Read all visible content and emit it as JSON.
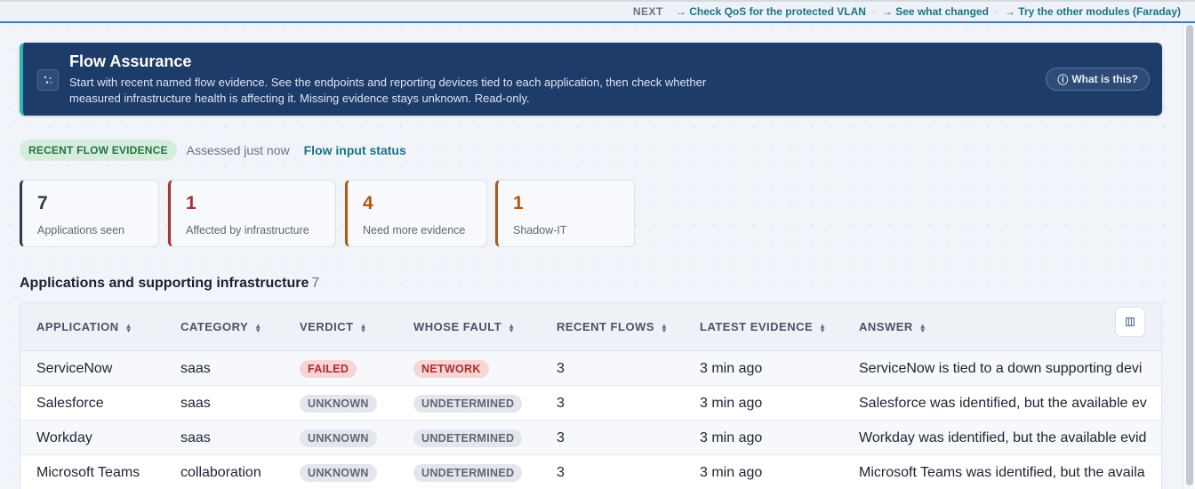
{
  "topbar": {
    "next_label": "NEXT",
    "links": [
      "→ Check QoS for the protected VLAN",
      "→ See what changed",
      "→ Try the other modules (Faraday)"
    ],
    "separator": "·"
  },
  "banner": {
    "icon": "sparkle-icon",
    "title": "Flow Assurance",
    "description": "Start with recent named flow evidence. See the endpoints and reporting devices tied to each application, then check whether measured infrastructure health is affecting it. Missing evidence stays unknown. Read-only.",
    "what_button": "What is this?",
    "what_button_icon": "ⓘ"
  },
  "status": {
    "badge": "RECENT FLOW EVIDENCE",
    "assessed": "Assessed just now",
    "link": "Flow input status"
  },
  "stats": [
    {
      "value": "7",
      "label": "Applications seen",
      "color": "#2f3a4d"
    },
    {
      "value": "1",
      "label": "Affected by infrastructure",
      "color": "#b32b2b"
    },
    {
      "value": "4",
      "label": "Need more evidence",
      "color": "#b5560f"
    },
    {
      "value": "1",
      "label": "Shadow-IT",
      "color": "#b5560f"
    }
  ],
  "section": {
    "title": "Applications and supporting infrastructure",
    "count": "7"
  },
  "table": {
    "columns": [
      "APPLICATION",
      "CATEGORY",
      "VERDICT",
      "WHOSE FAULT",
      "RECENT FLOWS",
      "LATEST EVIDENCE",
      "ANSWER"
    ],
    "sort_glyph": "▲▼",
    "column_button_icon": "columns-icon",
    "rows": [
      {
        "application": "ServiceNow",
        "category": "saas",
        "verdict": "FAILED",
        "fault": "NETWORK",
        "flows": "3",
        "latest": "3 min ago",
        "answer": "ServiceNow is tied to a down supporting devi"
      },
      {
        "application": "Salesforce",
        "category": "saas",
        "verdict": "UNKNOWN",
        "fault": "UNDETERMINED",
        "flows": "3",
        "latest": "3 min ago",
        "answer": "Salesforce was identified, but the available ev"
      },
      {
        "application": "Workday",
        "category": "saas",
        "verdict": "UNKNOWN",
        "fault": "UNDETERMINED",
        "flows": "3",
        "latest": "3 min ago",
        "answer": "Workday was identified, but the available evid"
      },
      {
        "application": "Microsoft Teams",
        "category": "collaboration",
        "verdict": "UNKNOWN",
        "fault": "UNDETERMINED",
        "flows": "3",
        "latest": "3 min ago",
        "answer": "Microsoft Teams was identified, but the availa"
      }
    ]
  }
}
